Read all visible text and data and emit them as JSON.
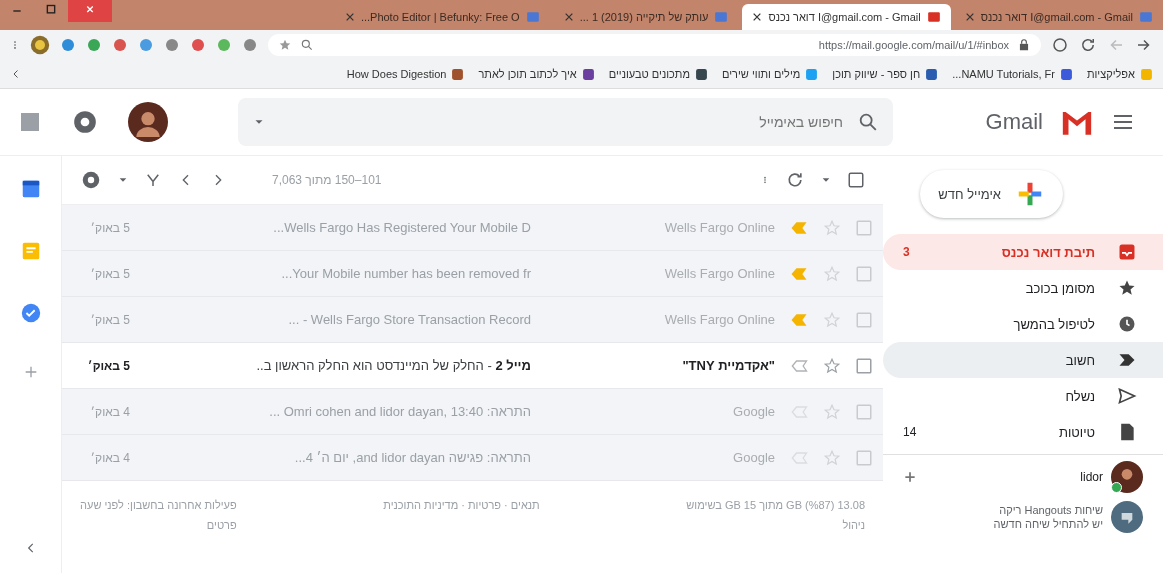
{
  "browser": {
    "tabs": [
      {
        "title": "I@gmail.com - Gmail דואר נכנס",
        "selected": false
      },
      {
        "title": "I@gmail.com - Gmail דואר נכנס",
        "selected": true
      },
      {
        "title": "עותק של תיקייה (2019) 1 ...",
        "selected": false
      },
      {
        "title": "Photo Editor | Befunky: Free O...",
        "selected": false
      }
    ],
    "url": "https://mail.google.com/mail/u/1/#inbox",
    "bookmarks": [
      "אפליקציות",
      "NAMU Tutorials, Fr...",
      "חן ספר - שיווק תוכן",
      "מילים ותווי שירים",
      "מתכונים טבעוניים",
      "איך לכתוב תוכן לאתר",
      "How Does Digestion"
    ]
  },
  "gmail": {
    "logo": "Gmail",
    "search": {
      "placeholder": "חיפוש באימייל"
    },
    "compose": "אימייל חדש",
    "nav": [
      {
        "label": "תיבת דואר נכנס",
        "count": "3",
        "selected": true,
        "hover": false
      },
      {
        "label": "מסומן בכוכב",
        "selected": false,
        "hover": false
      },
      {
        "label": "לטיפול בהמשך",
        "selected": false,
        "hover": false
      },
      {
        "label": "חשוב",
        "selected": false,
        "hover": true
      },
      {
        "label": "נשלח",
        "selected": false,
        "hover": false
      },
      {
        "label": "טיוטות",
        "count": "14",
        "selected": false,
        "hover": false
      }
    ],
    "hangouts": {
      "user": "lidor",
      "contact": "שיחות Hangouts ריקה",
      "hint": "יש להתחיל שיחה חדשה"
    },
    "pagination": "101–150 מתוך 7,063",
    "rows": [
      {
        "sender": "Wells Fargo Online",
        "subject": "Wells Fargo Has Registered Your Mobile D...",
        "date": "5 באוק׳",
        "important": true,
        "unread": false,
        "starred": false
      },
      {
        "sender": "Wells Fargo Online",
        "subject": "Your Mobile number has been removed fr...",
        "date": "5 באוק׳",
        "important": true,
        "unread": false,
        "starred": false
      },
      {
        "sender": "Wells Fargo Online",
        "subject": "Wells Fargo Store Transaction Record - ...",
        "date": "5 באוק׳",
        "important": true,
        "unread": false,
        "starred": false
      },
      {
        "sender": "\"אקדמיית TNY\"",
        "subject": "מייל 2",
        "snippet": " - החלק של המיינדסט הוא החלק הראשון ב..",
        "date": "5 באוק׳",
        "important": false,
        "unread": true,
        "starred": false
      },
      {
        "sender": "Google",
        "subject": "התראה: Omri cohen and lidor dayan, 13:40 ...",
        "date": "4 באוק׳",
        "important": false,
        "unread": false,
        "starred": false
      },
      {
        "sender": "Google",
        "subject": "התראה: פגישה and lidor dayan, יום ה׳ 4...",
        "date": "4 באוק׳",
        "important": false,
        "unread": false,
        "starred": false
      }
    ],
    "footer": {
      "storage": "13.08 GB (%87) מתוך 15 GB בשימוש",
      "manage": "ניהול",
      "links": "תנאים · פרטיות · מדיניות התוכנית",
      "activity": "פעילות אחרונה בחשבון: לפני שעה",
      "details": "פרטים"
    }
  }
}
